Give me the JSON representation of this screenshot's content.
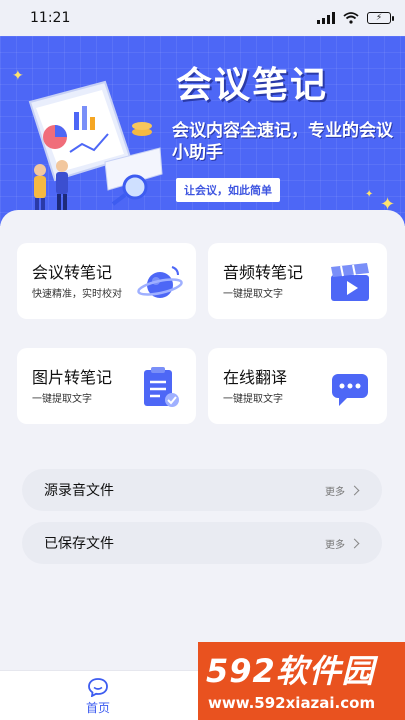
{
  "status_bar": {
    "time": "11:21",
    "battery": "⚡"
  },
  "banner": {
    "title": "会议笔记",
    "subtitle": "会议内容全速记，专业的会议小助手",
    "tag": "让会议，如此简单"
  },
  "cards": [
    {
      "title": "会议转笔记",
      "subtitle": "快速精准，实时校对",
      "icon": "planet-icon"
    },
    {
      "title": "音频转笔记",
      "subtitle": "一键提取文字",
      "icon": "video-clapper-icon"
    },
    {
      "title": "图片转笔记",
      "subtitle": "一键提取文字",
      "icon": "clipboard-icon"
    },
    {
      "title": "在线翻译",
      "subtitle": "一键提取文字",
      "icon": "chat-bubble-icon"
    }
  ],
  "lists": [
    {
      "label": "源录音文件",
      "more": "更多"
    },
    {
      "label": "已保存文件",
      "more": "更多"
    }
  ],
  "tabbar": {
    "home_label": "首页"
  },
  "watermark": {
    "logo": "592软件园",
    "url": "www.592xiazai.com"
  },
  "colors": {
    "brand": "#4d67f6",
    "accent": "#3d5cf0",
    "watermark": "#e9521f"
  }
}
